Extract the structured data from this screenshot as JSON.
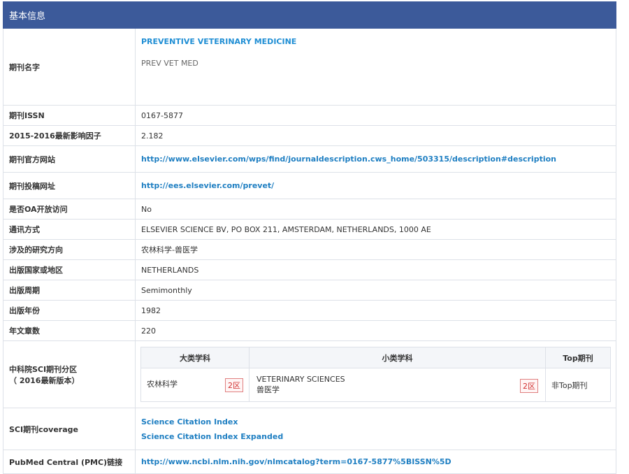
{
  "header": {
    "title": "基本信息"
  },
  "journal": {
    "name_label": "期刊名字",
    "full_name": "PREVENTIVE VETERINARY MEDICINE",
    "abbrev": "PREV VET MED"
  },
  "rows": {
    "issn": {
      "label": "期刊ISSN",
      "value": "0167-5877"
    },
    "impact": {
      "label": "2015-2016最新影响因子",
      "value": "2.182"
    },
    "website": {
      "label": "期刊官方网站",
      "value": "http://www.elsevier.com/wps/find/journaldescription.cws_home/503315/description#description"
    },
    "submit": {
      "label": "期刊投稿网址",
      "value": "http://ees.elsevier.com/prevet/"
    },
    "oa": {
      "label": "是否OA开放访问",
      "value": "No"
    },
    "contact": {
      "label": "通讯方式",
      "value": "ELSEVIER SCIENCE BV, PO BOX 211, AMSTERDAM, NETHERLANDS, 1000 AE"
    },
    "field": {
      "label": "涉及的研究方向",
      "value": "农林科学-兽医学"
    },
    "country": {
      "label": "出版国家或地区",
      "value": "NETHERLANDS"
    },
    "period": {
      "label": "出版周期",
      "value": "Semimonthly"
    },
    "year": {
      "label": "出版年份",
      "value": "1982"
    },
    "articles": {
      "label": "年文章数",
      "value": "220"
    }
  },
  "partition": {
    "label_line1": "中科院SCI期刊分区",
    "label_line2": "（ 2016最新版本）",
    "col_major": "大类学科",
    "col_minor": "小类学科",
    "col_top": "Top期刊",
    "major": "农林科学",
    "major_zone": "2区",
    "minor_en": "VETERINARY SCIENCES",
    "minor_cn": "兽医学",
    "minor_zone": "2区",
    "top": "非Top期刊"
  },
  "coverage": {
    "label": "SCI期刊coverage",
    "items": [
      "Science Citation Index",
      "Science Citation Index Expanded"
    ]
  },
  "pmc": {
    "label": "PubMed Central (PMC)链接",
    "value": "http://www.ncbi.nlm.nih.gov/nlmcatalog?term=0167-5877%5BISSN%5D"
  }
}
